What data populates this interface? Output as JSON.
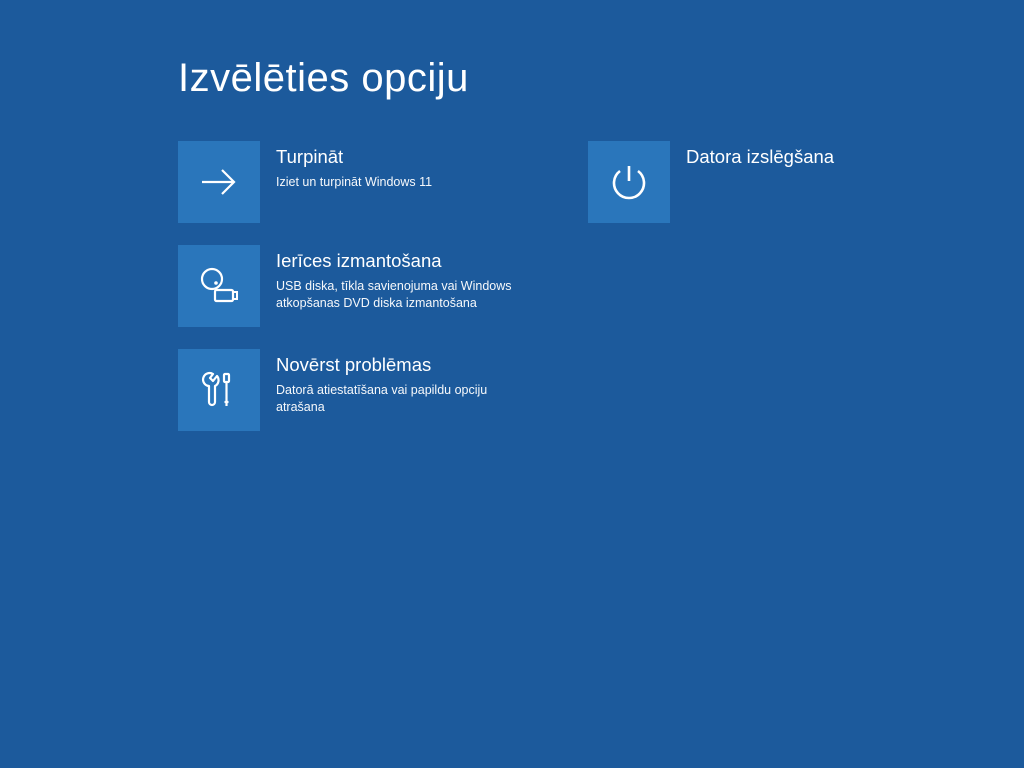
{
  "page_title": "Izvēlēties opciju",
  "options": {
    "continue": {
      "title": "Turpināt",
      "desc": "Iziet un turpināt Windows 11"
    },
    "use_device": {
      "title": "Ierīces izmantošana",
      "desc": "USB diska, tīkla savienojuma vai Windows atkopšanas DVD diska izmantošana"
    },
    "troubleshoot": {
      "title": "Novērst problēmas",
      "desc": "Datorā atiestatīšana vai papildu opciju atrašana"
    },
    "shutdown": {
      "title": "Datora izslēgšana",
      "desc": ""
    }
  }
}
